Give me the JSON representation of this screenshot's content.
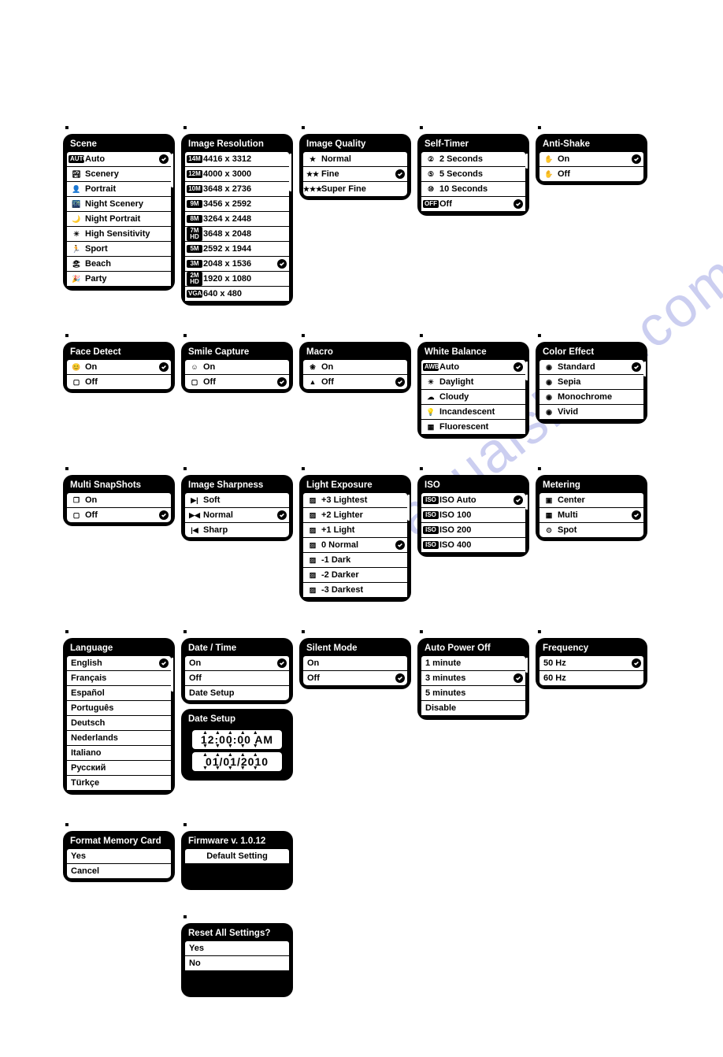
{
  "watermark": "manualshive.com",
  "menus": {
    "scene": {
      "title": "Scene",
      "items": [
        {
          "icon": "AUTO",
          "label": "Auto",
          "selected": true
        },
        {
          "icon": "🏞",
          "label": "Scenery"
        },
        {
          "icon": "👤",
          "label": "Portrait"
        },
        {
          "icon": "🌃",
          "label": "Night Scenery"
        },
        {
          "icon": "🌙",
          "label": "Night Portrait"
        },
        {
          "icon": "☀",
          "label": "High Sensitivity"
        },
        {
          "icon": "🏃",
          "label": "Sport"
        },
        {
          "icon": "🏖",
          "label": "Beach"
        },
        {
          "icon": "🎉",
          "label": "Party"
        }
      ]
    },
    "resolution": {
      "title": "Image Resolution",
      "items": [
        {
          "icon": "14M",
          "label": "4416 x 3312"
        },
        {
          "icon": "12M",
          "label": "4000 x 3000"
        },
        {
          "icon": "10M",
          "label": "3648 x 2736"
        },
        {
          "icon": "9M",
          "label": "3456 x 2592"
        },
        {
          "icon": "8M",
          "label": "3264 x 2448"
        },
        {
          "icon": "7M HD",
          "label": "3648 x 2048"
        },
        {
          "icon": "5M",
          "label": "2592 x 1944"
        },
        {
          "icon": "3M",
          "label": "2048 x 1536",
          "selected": true
        },
        {
          "icon": "2M HD",
          "label": "1920 x 1080"
        },
        {
          "icon": "VGA",
          "label": "640 x 480"
        }
      ]
    },
    "quality": {
      "title": "Image Quality",
      "items": [
        {
          "icon": "★",
          "label": "Normal"
        },
        {
          "icon": "★★",
          "label": "Fine",
          "selected": true
        },
        {
          "icon": "★★★",
          "label": "Super Fine"
        }
      ]
    },
    "selftimer": {
      "title": "Self-Timer",
      "items": [
        {
          "icon": "②",
          "label": "2 Seconds"
        },
        {
          "icon": "⑤",
          "label": "5 Seconds"
        },
        {
          "icon": "⑩",
          "label": "10 Seconds"
        },
        {
          "icon": "OFF",
          "label": "Off",
          "selected": true
        }
      ]
    },
    "antishake": {
      "title": "Anti-Shake",
      "items": [
        {
          "icon": "✋",
          "label": "On",
          "selected": true
        },
        {
          "icon": "✋",
          "label": "Off"
        }
      ]
    },
    "facedetect": {
      "title": "Face Detect",
      "items": [
        {
          "icon": "😊",
          "label": "On",
          "selected": true
        },
        {
          "icon": "▢",
          "label": "Off"
        }
      ]
    },
    "smile": {
      "title": "Smile Capture",
      "items": [
        {
          "icon": "☺",
          "label": "On"
        },
        {
          "icon": "▢",
          "label": "Off",
          "selected": true
        }
      ]
    },
    "macro": {
      "title": "Macro",
      "items": [
        {
          "icon": "❀",
          "label": "On"
        },
        {
          "icon": "▲",
          "label": "Off",
          "selected": true
        }
      ]
    },
    "wb": {
      "title": "White Balance",
      "items": [
        {
          "icon": "AWB",
          "label": "Auto",
          "selected": true
        },
        {
          "icon": "☀",
          "label": "Daylight"
        },
        {
          "icon": "☁",
          "label": "Cloudy"
        },
        {
          "icon": "💡",
          "label": "Incandescent"
        },
        {
          "icon": "▦",
          "label": "Fluorescent"
        }
      ]
    },
    "coloreffect": {
      "title": "Color Effect",
      "items": [
        {
          "icon": "◉",
          "label": "Standard",
          "selected": true
        },
        {
          "icon": "◉",
          "label": "Sepia"
        },
        {
          "icon": "◉",
          "label": "Monochrome"
        },
        {
          "icon": "◉",
          "label": "Vivid"
        }
      ]
    },
    "multisnap": {
      "title": "Multi SnapShots",
      "items": [
        {
          "icon": "❐",
          "label": "On"
        },
        {
          "icon": "▢",
          "label": "Off",
          "selected": true
        }
      ]
    },
    "sharpness": {
      "title": "Image Sharpness",
      "items": [
        {
          "icon": "▶|",
          "label": "Soft"
        },
        {
          "icon": "▶◀",
          "label": "Normal",
          "selected": true
        },
        {
          "icon": "|◀",
          "label": "Sharp"
        }
      ]
    },
    "exposure": {
      "title": "Light Exposure",
      "items": [
        {
          "icon": "▨",
          "label": "+3 Lightest"
        },
        {
          "icon": "▨",
          "label": "+2 Lighter"
        },
        {
          "icon": "▨",
          "label": "+1 Light"
        },
        {
          "icon": "▨",
          "label": "0 Normal",
          "selected": true
        },
        {
          "icon": "▨",
          "label": "-1 Dark"
        },
        {
          "icon": "▨",
          "label": "-2 Darker"
        },
        {
          "icon": "▨",
          "label": "-3 Darkest"
        }
      ]
    },
    "iso": {
      "title": "ISO",
      "items": [
        {
          "icon": "ISO",
          "label": "ISO Auto",
          "selected": true
        },
        {
          "icon": "ISO",
          "label": "ISO 100"
        },
        {
          "icon": "ISO",
          "label": "ISO 200"
        },
        {
          "icon": "ISO",
          "label": "ISO 400"
        }
      ]
    },
    "metering": {
      "title": "Metering",
      "items": [
        {
          "icon": "▣",
          "label": "Center"
        },
        {
          "icon": "▦",
          "label": "Multi",
          "selected": true
        },
        {
          "icon": "⊙",
          "label": "Spot"
        }
      ]
    },
    "language": {
      "title": "Language",
      "items": [
        {
          "label": "English",
          "selected": true
        },
        {
          "label": "Français"
        },
        {
          "label": "Español"
        },
        {
          "label": "Português"
        },
        {
          "label": "Deutsch"
        },
        {
          "label": "Nederlands"
        },
        {
          "label": "Italiano"
        },
        {
          "label": "Русский"
        },
        {
          "label": "Türkçe"
        }
      ]
    },
    "datetime": {
      "title": "Date / Time",
      "items": [
        {
          "label": "On",
          "selected": true
        },
        {
          "label": "Off"
        },
        {
          "label": "Date Setup"
        }
      ]
    },
    "datesetup": {
      "title": "Date Setup",
      "time": "12:00:00 AM",
      "date": "01/01/2010"
    },
    "silent": {
      "title": "Silent Mode",
      "items": [
        {
          "label": "On"
        },
        {
          "label": "Off",
          "selected": true
        }
      ]
    },
    "autopower": {
      "title": "Auto Power Off",
      "items": [
        {
          "label": "1 minute"
        },
        {
          "label": "3 minutes",
          "selected": true
        },
        {
          "label": "5 minutes"
        },
        {
          "label": "Disable"
        }
      ]
    },
    "frequency": {
      "title": "Frequency",
      "items": [
        {
          "label": "50 Hz",
          "selected": true
        },
        {
          "label": "60 Hz"
        }
      ]
    },
    "format": {
      "title": "Format Memory Card",
      "items": [
        {
          "label": "Yes"
        },
        {
          "label": "Cancel"
        }
      ]
    },
    "firmware": {
      "title": "Firmware v. 1.0.12",
      "items": [
        {
          "label": "Default Setting",
          "center": true
        }
      ]
    },
    "reset": {
      "title": "Reset All Settings?",
      "items": [
        {
          "label": "Yes"
        },
        {
          "label": "No"
        }
      ]
    }
  }
}
